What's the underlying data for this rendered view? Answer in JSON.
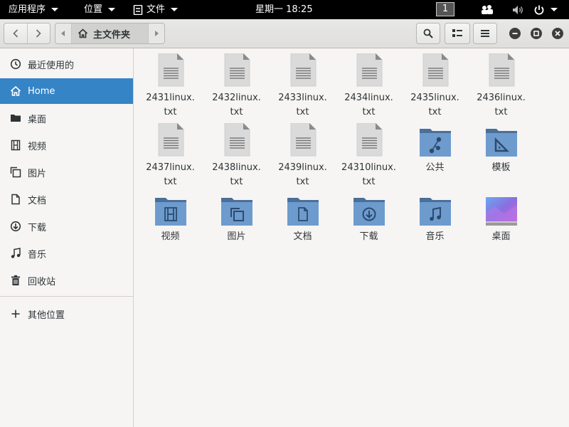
{
  "topbar": {
    "apps_label": "应用程序",
    "places_label": "位置",
    "files_label": "文件",
    "clock": "星期一 18:25",
    "workspace": "1"
  },
  "headerbar": {
    "path_crumb": "主文件夹"
  },
  "sidebar": {
    "items": [
      {
        "label": "最近使用的",
        "icon": "clock-icon"
      },
      {
        "label": "Home",
        "icon": "home-icon",
        "active": true
      },
      {
        "label": "桌面",
        "icon": "folder-icon"
      },
      {
        "label": "视频",
        "icon": "film-icon"
      },
      {
        "label": "图片",
        "icon": "image-icon"
      },
      {
        "label": "文档",
        "icon": "document-icon"
      },
      {
        "label": "下载",
        "icon": "download-icon"
      },
      {
        "label": "音乐",
        "icon": "music-icon"
      },
      {
        "label": "回收站",
        "icon": "trash-icon"
      },
      {
        "label": "其他位置",
        "icon": "plus-icon"
      }
    ]
  },
  "files": [
    {
      "name": "2431linux.\ntxt",
      "type": "text-file-icon"
    },
    {
      "name": "2432linux.\ntxt",
      "type": "text-file-icon"
    },
    {
      "name": "2433linux.\ntxt",
      "type": "text-file-icon"
    },
    {
      "name": "2434linux.\ntxt",
      "type": "text-file-icon"
    },
    {
      "name": "2435linux.\ntxt",
      "type": "text-file-icon"
    },
    {
      "name": "2436linux.\ntxt",
      "type": "text-file-icon"
    },
    {
      "name": "2437linux.\ntxt",
      "type": "text-file-icon"
    },
    {
      "name": "2438linux.\ntxt",
      "type": "text-file-icon"
    },
    {
      "name": "2439linux.\ntxt",
      "type": "text-file-icon"
    },
    {
      "name": "24310linux.\ntxt",
      "type": "text-file-icon"
    },
    {
      "name": "公共",
      "type": "folder-public-icon"
    },
    {
      "name": "模板",
      "type": "folder-templates-icon"
    },
    {
      "name": "视频",
      "type": "folder-videos-icon"
    },
    {
      "name": "图片",
      "type": "folder-pictures-icon"
    },
    {
      "name": "文档",
      "type": "folder-documents-icon"
    },
    {
      "name": "下载",
      "type": "folder-downloads-icon"
    },
    {
      "name": "音乐",
      "type": "folder-music-icon"
    },
    {
      "name": "桌面",
      "type": "folder-desktop-icon"
    }
  ],
  "colors": {
    "accent": "#3584c6",
    "folder": "#6e9bcd",
    "folder_dark": "#4a6f98",
    "topbar": "#000000"
  }
}
